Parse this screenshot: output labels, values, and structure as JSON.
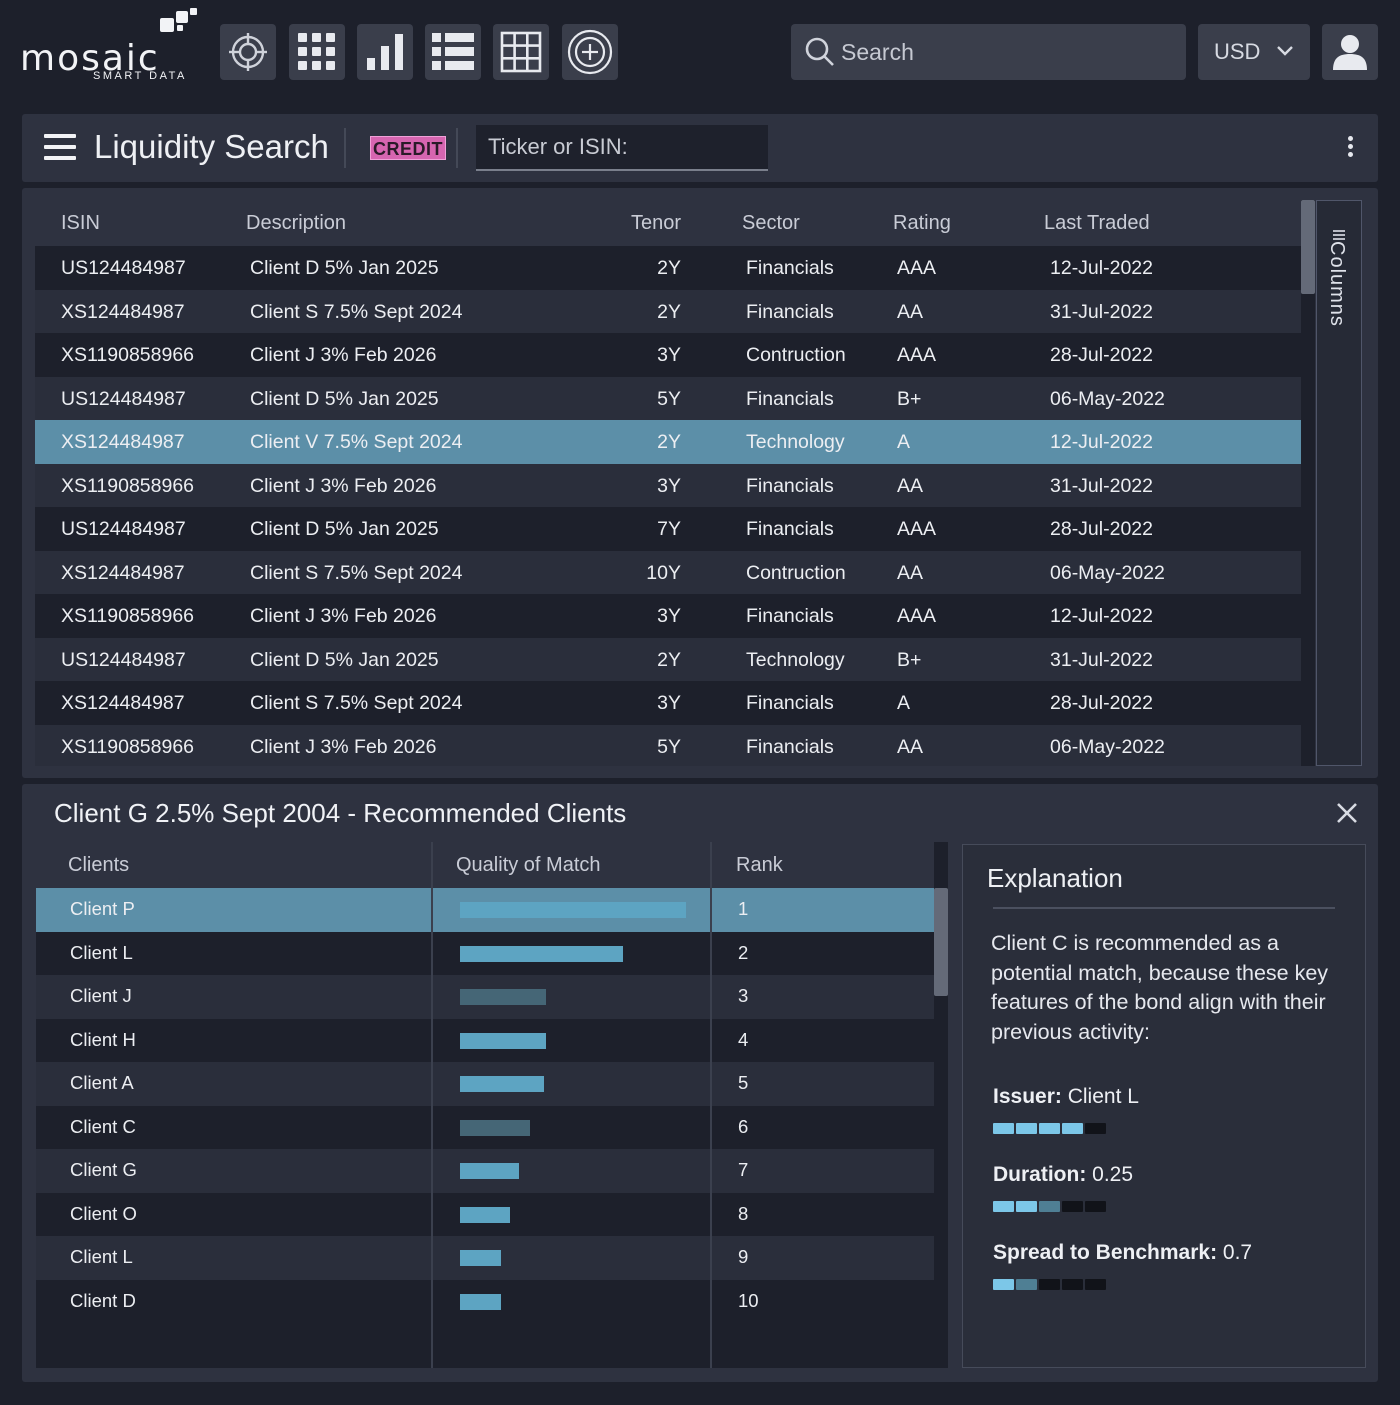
{
  "logo": {
    "word": "mosaic",
    "sub": "SMART DATA"
  },
  "toolbar_icons": [
    "crosshair-icon",
    "apps-grid-icon",
    "bar-chart-icon",
    "list-icon",
    "table-icon",
    "add-circle-icon"
  ],
  "search": {
    "placeholder": "Search"
  },
  "currency": {
    "value": "USD"
  },
  "liquidity": {
    "title": "Liquidity Search",
    "badge": "CREDIT",
    "ticker_placeholder": "Ticker or ISIN:"
  },
  "bond_table": {
    "columns": [
      "ISIN",
      "Description",
      "Tenor",
      "Sector",
      "Rating",
      "Last Traded"
    ],
    "rows": [
      {
        "isin": "US124484987",
        "desc": "Client D 5% Jan 2025",
        "tenor": "2Y",
        "sector": "Financials",
        "rating": "AAA",
        "last": "12-Jul-2022"
      },
      {
        "isin": "XS124484987",
        "desc": "Client S 7.5% Sept 2024",
        "tenor": "2Y",
        "sector": "Financials",
        "rating": "AA",
        "last": "31-Jul-2022"
      },
      {
        "isin": "XS1190858966",
        "desc": "Client J 3% Feb 2026",
        "tenor": "3Y",
        "sector": "Contruction",
        "rating": "AAA",
        "last": "28-Jul-2022"
      },
      {
        "isin": "US124484987",
        "desc": "Client D 5% Jan 2025",
        "tenor": "5Y",
        "sector": "Financials",
        "rating": "B+",
        "last": "06-May-2022"
      },
      {
        "isin": "XS124484987",
        "desc": "Client V 7.5% Sept 2024",
        "tenor": "2Y",
        "sector": "Technology",
        "rating": "A",
        "last": "12-Jul-2022",
        "selected": true
      },
      {
        "isin": "XS1190858966",
        "desc": "Client J 3% Feb 2026",
        "tenor": "3Y",
        "sector": "Financials",
        "rating": "AA",
        "last": "31-Jul-2022"
      },
      {
        "isin": "US124484987",
        "desc": "Client D 5% Jan 2025",
        "tenor": "7Y",
        "sector": "Financials",
        "rating": "AAA",
        "last": "28-Jul-2022"
      },
      {
        "isin": "XS124484987",
        "desc": "Client S 7.5% Sept 2024",
        "tenor": "10Y",
        "sector": "Contruction",
        "rating": "AA",
        "last": "06-May-2022"
      },
      {
        "isin": "XS1190858966",
        "desc": "Client J 3% Feb 2026",
        "tenor": "3Y",
        "sector": "Financials",
        "rating": "AAA",
        "last": "12-Jul-2022"
      },
      {
        "isin": "US124484987",
        "desc": "Client D 5% Jan 2025",
        "tenor": "2Y",
        "sector": "Technology",
        "rating": "B+",
        "last": "31-Jul-2022"
      },
      {
        "isin": "XS124484987",
        "desc": "Client S 7.5% Sept 2024",
        "tenor": "3Y",
        "sector": "Financials",
        "rating": "A",
        "last": "28-Jul-2022"
      },
      {
        "isin": "XS1190858966",
        "desc": "Client J 3% Feb 2026",
        "tenor": "5Y",
        "sector": "Financials",
        "rating": "AA",
        "last": "06-May-2022"
      }
    ],
    "columns_tab": "Columns"
  },
  "recommended": {
    "title": "Client G 2.5% Sept 2004 - Recommended Clients",
    "columns": [
      "Clients",
      "Quality of Match",
      "Rank"
    ],
    "rows": [
      {
        "client": "Client P",
        "quality": 1.0,
        "rank": "1",
        "selected": true,
        "shade": "bright"
      },
      {
        "client": "Client L",
        "quality": 0.72,
        "rank": "2",
        "shade": "bright"
      },
      {
        "client": "Client J",
        "quality": 0.38,
        "rank": "3",
        "shade": "dim"
      },
      {
        "client": "Client H",
        "quality": 0.38,
        "rank": "4",
        "shade": "bright"
      },
      {
        "client": "Client A",
        "quality": 0.37,
        "rank": "5",
        "shade": "bright"
      },
      {
        "client": "Client C",
        "quality": 0.31,
        "rank": "6",
        "shade": "dim"
      },
      {
        "client": "Client G",
        "quality": 0.26,
        "rank": "7",
        "shade": "bright"
      },
      {
        "client": "Client O",
        "quality": 0.22,
        "rank": "8",
        "shade": "bright"
      },
      {
        "client": "Client L",
        "quality": 0.18,
        "rank": "9",
        "shade": "bright"
      },
      {
        "client": "Client D",
        "quality": 0.18,
        "rank": "10",
        "shade": "bright"
      }
    ]
  },
  "explanation": {
    "title": "Explanation",
    "text": "Client C is recommended as a potential match, because these key features of the bond align with their previous activity:",
    "features": [
      {
        "label": "Issuer:",
        "value": "Client L",
        "pips": [
          "high",
          "high",
          "high",
          "high",
          "off"
        ]
      },
      {
        "label": "Duration:",
        "value": "0.25",
        "pips": [
          "high",
          "high",
          "mid",
          "off",
          "off"
        ]
      },
      {
        "label": "Spread to Benchmark:",
        "value": "0.7",
        "pips": [
          "high",
          "mid",
          "off",
          "off",
          "off"
        ]
      }
    ]
  },
  "colors": {
    "background": "#1d202b",
    "panel": "#2e3240",
    "selected_row": "#5c8fa8",
    "bar_bright": "#5da4c2",
    "bar_dim": "#456676",
    "pip_high": "#7cc7e8",
    "pip_mid": "#4f7f94",
    "pip_off": "#111319",
    "badge": "#d665b0"
  }
}
